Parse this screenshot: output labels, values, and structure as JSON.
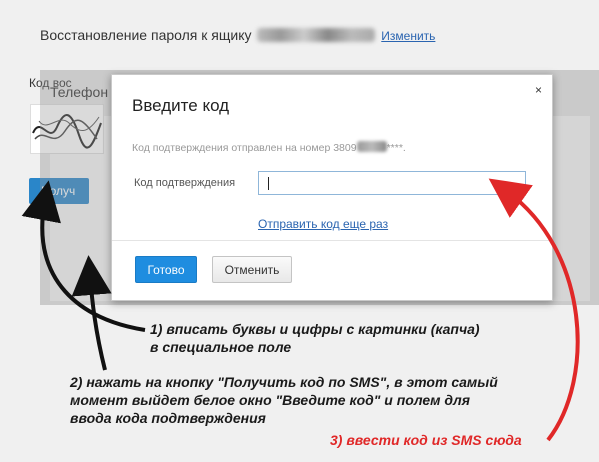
{
  "header": {
    "title": "Восстановление пароля к ящику",
    "change_link": "Изменить"
  },
  "background": {
    "panel_title": "Телефон",
    "code_label": "Код вос",
    "button_label": "Получ"
  },
  "modal": {
    "title": "Введите код",
    "close": "×",
    "info": "Код подтверждения отправлен на номер 3809",
    "info_suffix": "****.",
    "field_label": "Код подтверждения",
    "input_value": "",
    "resend_link": "Отправить код еще раз",
    "ok_button": "Готово",
    "cancel_button": "Отменить"
  },
  "annotations": {
    "step1_line1": "1) вписать буквы и цифры с картинки (капча)",
    "step1_line2": "в специальное поле",
    "step2_line1": "2) нажать на кнопку \"Получить код по SMS\", в этот самый",
    "step2_line2": "момент выйдет белое окно \"Введите код\" и полем для",
    "step2_line3": "ввода кода подтверждения",
    "step3": "3) ввести код из SMS сюда"
  },
  "colors": {
    "accent": "#1f8de0",
    "link": "#2a64b0",
    "annotation_red": "#e02828"
  }
}
